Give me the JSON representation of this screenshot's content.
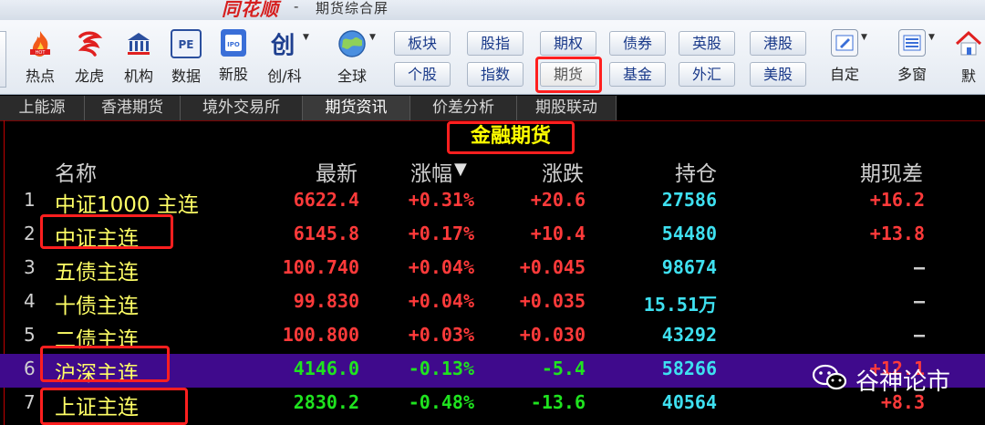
{
  "app": {
    "logo_text": "同花顺",
    "separator": "-",
    "window_title": "期货综合屏"
  },
  "toolbar": {
    "tools": [
      {
        "label": "热点",
        "icon": "hot-flame-icon"
      },
      {
        "label": "龙虎",
        "icon": "dragon-tiger-icon"
      },
      {
        "label": "机构",
        "icon": "institution-bank-icon"
      },
      {
        "label": "数据",
        "icon": "pe-data-icon"
      },
      {
        "label": "新股",
        "icon": "ipo-icon"
      },
      {
        "label": "创/科",
        "icon": "chuang-icon"
      },
      {
        "label": "全球",
        "icon": "globe-icon"
      }
    ],
    "buttons_top": [
      "板块",
      "股指",
      "期权",
      "债券",
      "英股",
      "港股"
    ],
    "buttons_bottom": [
      "个股",
      "指数",
      "期货",
      "基金",
      "外汇",
      "美股"
    ],
    "active_button": "期货",
    "right_tools": [
      {
        "label": "自定",
        "icon": "customize-icon"
      },
      {
        "label": "多窗",
        "icon": "multi-window-icon"
      },
      {
        "label": "默",
        "icon": "home-icon"
      }
    ]
  },
  "tabs": [
    "上能源",
    "香港期货",
    "境外交易所",
    "期货资讯",
    "价差分析",
    "期股联动"
  ],
  "section_title": "金融期货",
  "table": {
    "headers": {
      "name": "名称",
      "latest": "最新",
      "change_pct": "涨幅",
      "change": "涨跌",
      "open_interest": "持仓",
      "basis": "期现差"
    },
    "rows": [
      {
        "index": "1",
        "name": "中证1000 主连",
        "latest": "6622.4",
        "change_pct": "+0.31%",
        "change": "+20.6",
        "open_interest": "27586",
        "basis": "+16.2",
        "trend": "up"
      },
      {
        "index": "2",
        "name": "中证主连",
        "latest": "6145.8",
        "change_pct": "+0.17%",
        "change": "+10.4",
        "open_interest": "54480",
        "basis": "+13.8",
        "trend": "up"
      },
      {
        "index": "3",
        "name": "五债主连",
        "latest": "100.740",
        "change_pct": "+0.04%",
        "change": "+0.045",
        "open_interest": "98674",
        "basis": "–",
        "trend": "up"
      },
      {
        "index": "4",
        "name": "十债主连",
        "latest": "99.830",
        "change_pct": "+0.04%",
        "change": "+0.035",
        "open_interest": "15.51万",
        "basis": "–",
        "trend": "up"
      },
      {
        "index": "5",
        "name": "二债主连",
        "latest": "100.800",
        "change_pct": "+0.03%",
        "change": "+0.030",
        "open_interest": "43292",
        "basis": "–",
        "trend": "up"
      },
      {
        "index": "6",
        "name": "沪深主连",
        "latest": "4146.0",
        "change_pct": "-0.13%",
        "change": "-5.4",
        "open_interest": "58266",
        "basis": "+12.1",
        "trend": "down"
      },
      {
        "index": "7",
        "name": "上证主连",
        "latest": "2830.2",
        "change_pct": "-0.48%",
        "change": "-13.6",
        "open_interest": "40564",
        "basis": "+8.3",
        "trend": "down"
      }
    ],
    "selected_index": "6"
  },
  "colors": {
    "up": "#ff3a3a",
    "down": "#1fe31f",
    "open_interest": "#3ee0f0",
    "name": "#ffff66",
    "section_title": "#ffff00",
    "selected_row": "#3f0a8c",
    "highlight_box": "#ff1f1f"
  },
  "watermark": {
    "icon": "wechat-icon",
    "text": "谷神论市"
  }
}
